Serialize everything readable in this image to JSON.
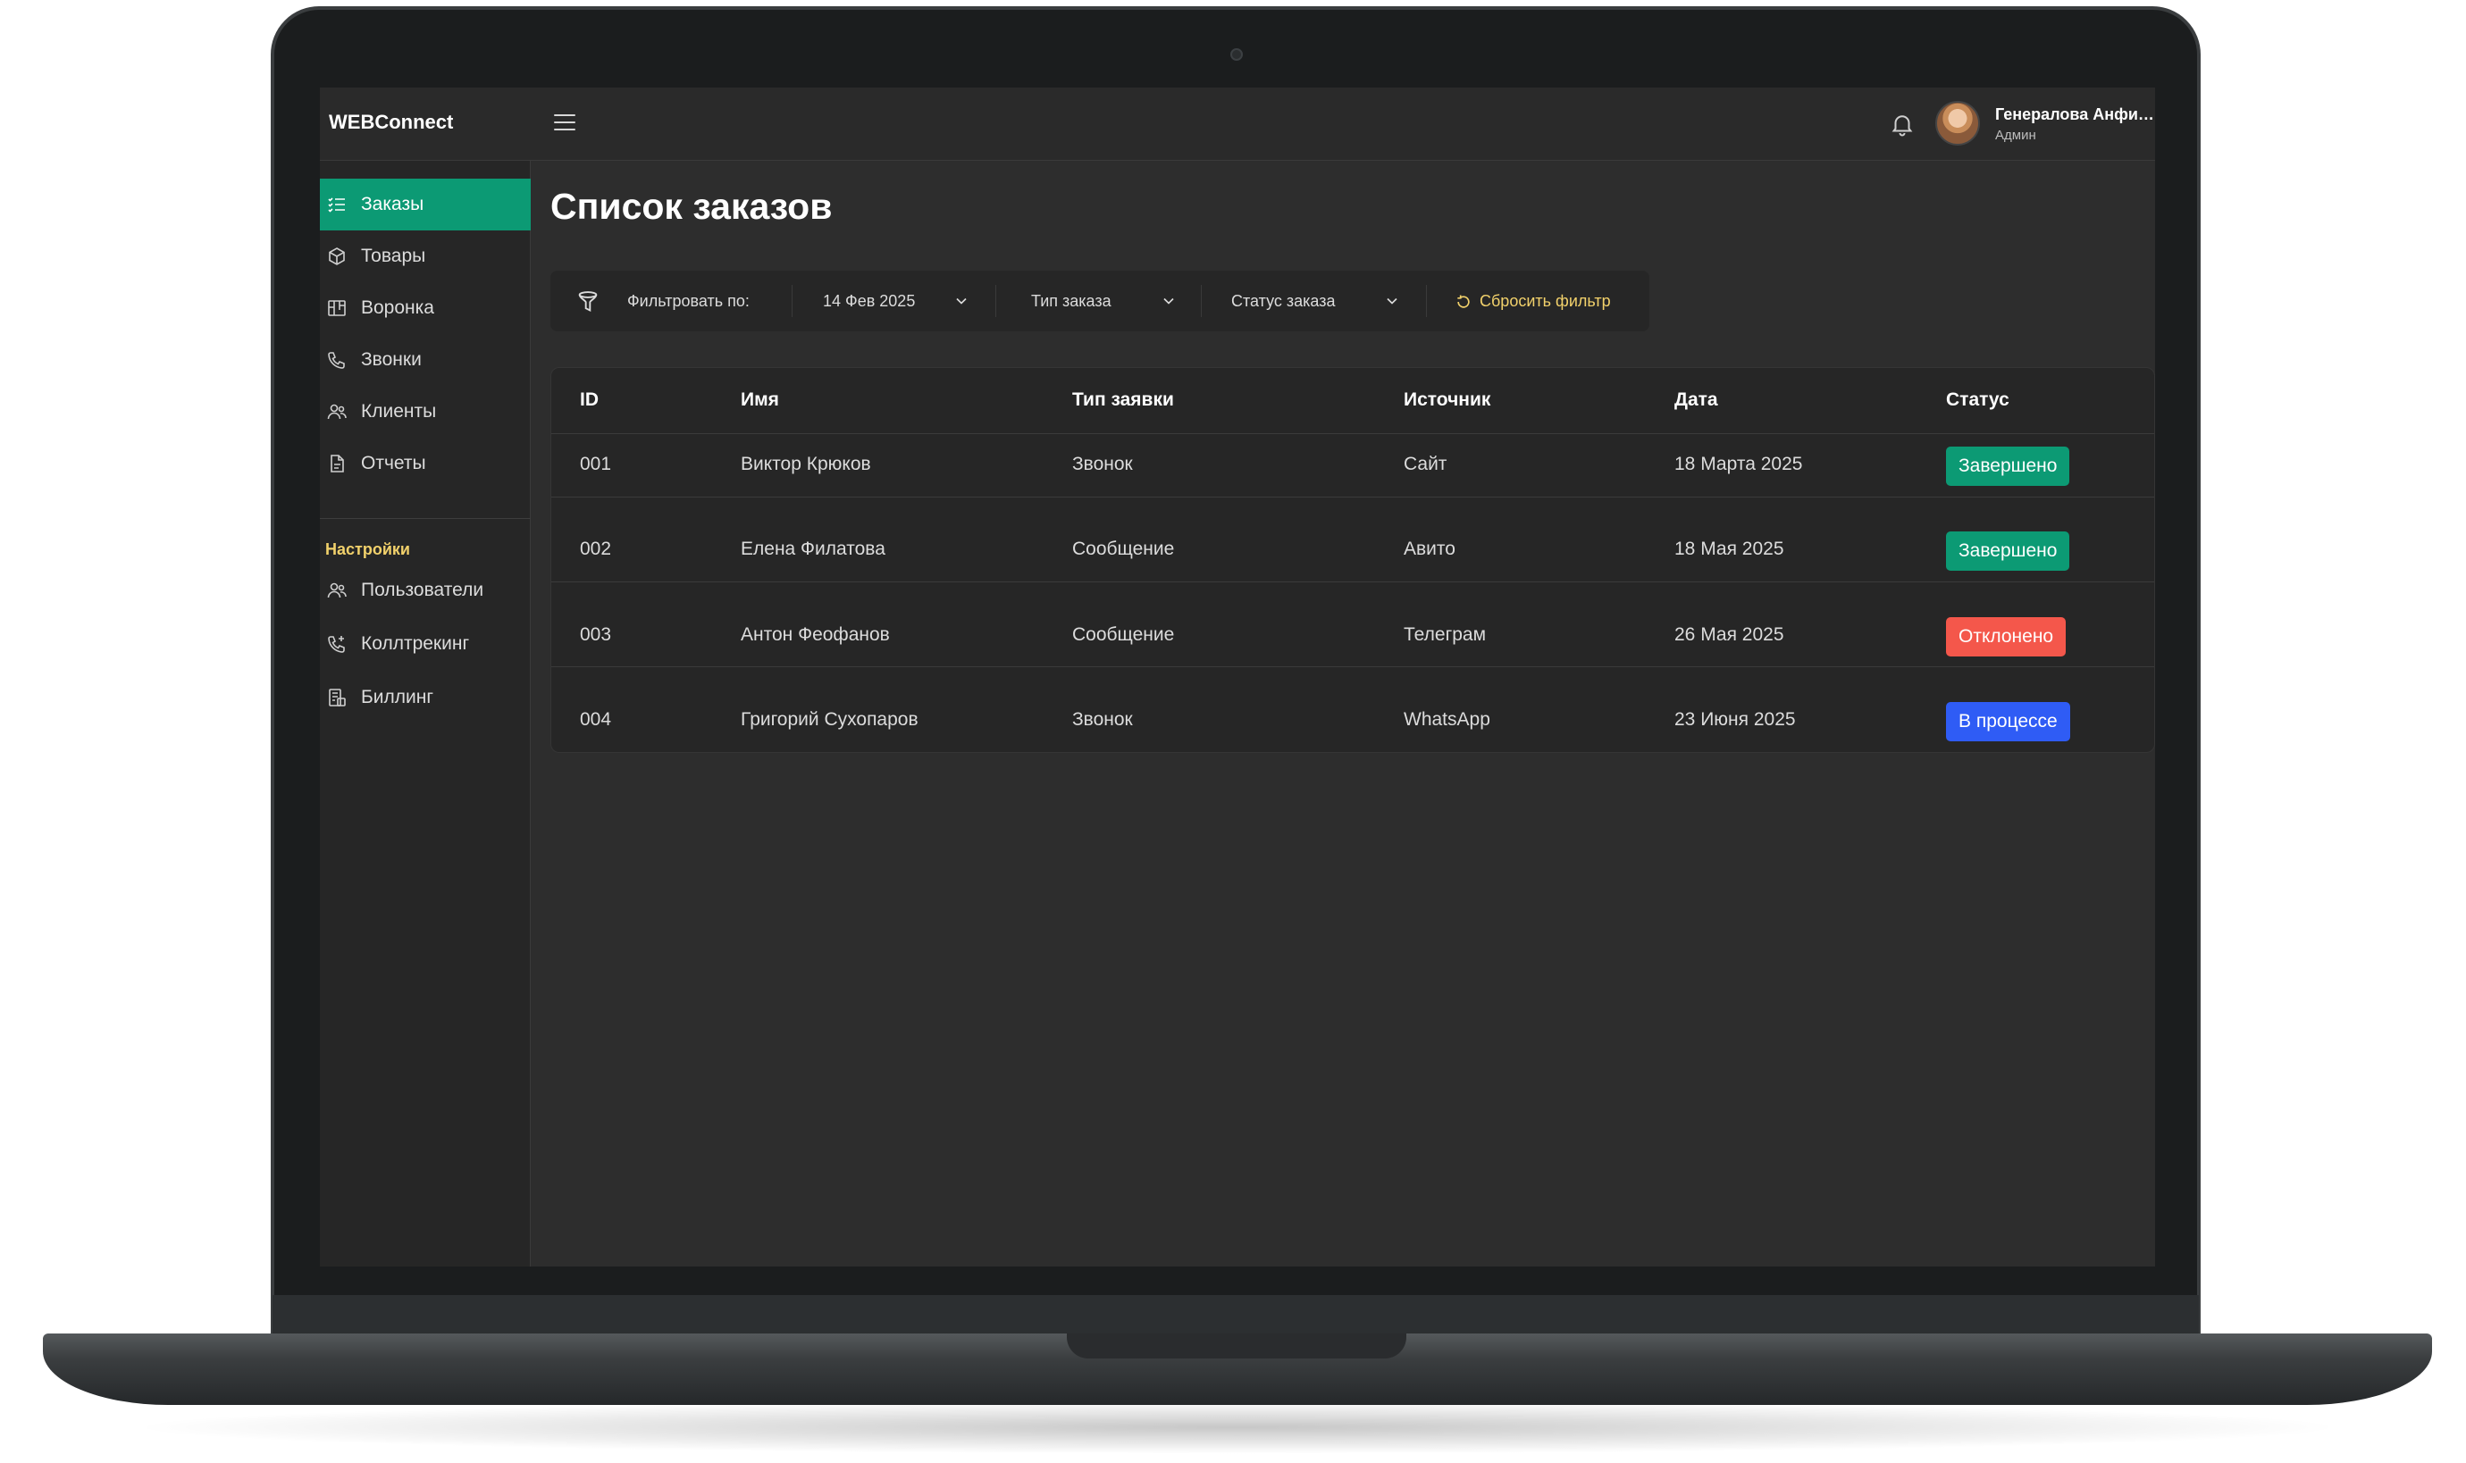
{
  "app": {
    "brand": "WEBConnect"
  },
  "user": {
    "name": "Генералова Анфиса",
    "role": "Админ"
  },
  "sidebar": {
    "items": [
      {
        "label": "Заказы",
        "icon": "list-check-icon",
        "active": true
      },
      {
        "label": "Товары",
        "icon": "box-icon"
      },
      {
        "label": "Воронка",
        "icon": "kanban-icon"
      },
      {
        "label": "Звонки",
        "icon": "phone-icon"
      },
      {
        "label": "Клиенты",
        "icon": "users-icon"
      },
      {
        "label": "Отчеты",
        "icon": "document-icon"
      }
    ],
    "settings_title": "Настройки",
    "settings_items": [
      {
        "label": "Пользователи",
        "icon": "users-icon"
      },
      {
        "label": "Коллтрекинг",
        "icon": "phone-plus-icon"
      },
      {
        "label": "Биллинг",
        "icon": "billing-icon"
      }
    ]
  },
  "main": {
    "title": "Список заказов",
    "filter": {
      "label": "Фильтровать по:",
      "date": "14 Фев 2025",
      "order_type": "Тип заказа",
      "order_status": "Статус заказа",
      "reset": "Сбросить фильтр"
    },
    "table": {
      "columns": [
        "ID",
        "Имя",
        "Тип заявки",
        "Источник",
        "Дата",
        "Статус"
      ],
      "rows": [
        {
          "id": "001",
          "name": "Виктор Крюков",
          "type": "Звонок",
          "source": "Сайт",
          "date": "18 Марта 2025",
          "status": "Завершено",
          "status_color": "#0c9a74"
        },
        {
          "id": "002",
          "name": "Елена Филатова",
          "type": "Сообщение",
          "source": "Авито",
          "date": "18 Мая 2025",
          "status": "Завершено",
          "status_color": "#0c9a74"
        },
        {
          "id": "003",
          "name": "Антон Феофанов",
          "type": "Сообщение",
          "source": "Телеграм",
          "date": "26 Мая 2025",
          "status": "Отклонено",
          "status_color": "#f4574b"
        },
        {
          "id": "004",
          "name": "Григорий Сухопаров",
          "type": "Звонок",
          "source": "WhatsApp",
          "date": "23 Июня 2025",
          "status": "В процессе",
          "status_color": "#2f5cf5"
        }
      ]
    }
  },
  "colors": {
    "accent": "#0c9a74",
    "highlight": "#f2d16b"
  }
}
